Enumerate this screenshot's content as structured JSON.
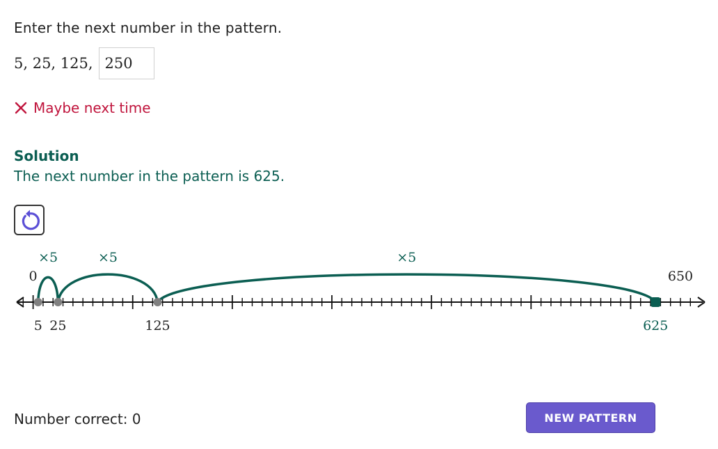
{
  "prompt": "Enter the next number in the pattern.",
  "sequence": {
    "terms_text": "5, 25, 125,",
    "answer_value": "250"
  },
  "feedback": {
    "icon": "close-icon",
    "text": "Maybe next time",
    "color": "#c0143c"
  },
  "solution": {
    "heading": "Solution",
    "text": "The next number in the pattern is 625.",
    "color": "#0b5e52"
  },
  "reset_icon": "reset-icon",
  "number_line": {
    "min": 0,
    "max": 650,
    "minor_step": 10,
    "major_step": 100,
    "end_labels": [
      "0",
      "650"
    ],
    "points": [
      {
        "value": 5,
        "label": "5",
        "color": "#808080"
      },
      {
        "value": 25,
        "label": "25",
        "color": "#808080"
      },
      {
        "value": 125,
        "label": "125",
        "color": "#808080"
      },
      {
        "value": 625,
        "label": "625",
        "color": "#0b5e52"
      }
    ],
    "jumps": [
      {
        "from": 5,
        "to": 25,
        "label": "×5"
      },
      {
        "from": 25,
        "to": 125,
        "label": "×5"
      },
      {
        "from": 125,
        "to": 625,
        "label": "×5"
      }
    ],
    "arc_color": "#0b5e52"
  },
  "footer": {
    "counter_text": "Number correct: 0",
    "new_pattern_label": "NEW PATTERN",
    "button_color": "#6a5acd"
  }
}
